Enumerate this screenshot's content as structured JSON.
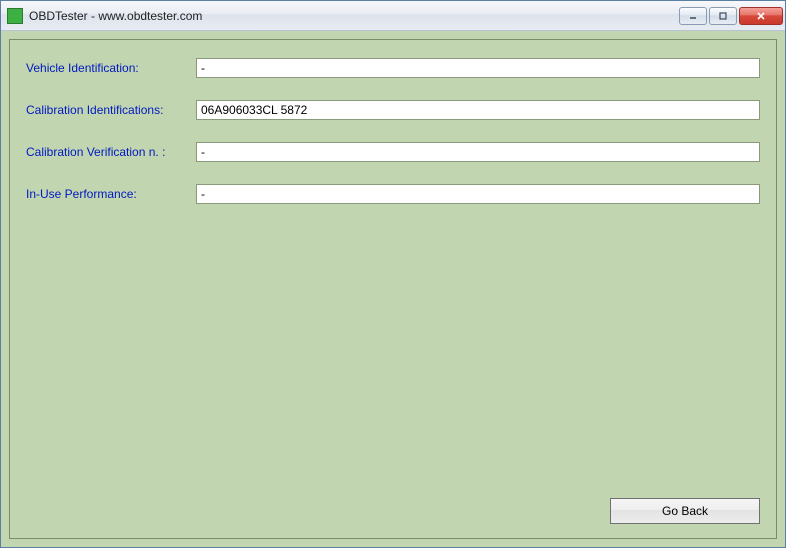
{
  "window": {
    "title": "OBDTester - www.obdtester.com"
  },
  "fields": {
    "vehicle_id": {
      "label": "Vehicle Identification:",
      "value": "-"
    },
    "calib_id": {
      "label": "Calibration Identifications:",
      "value": "06A906033CL 5872"
    },
    "calib_verif": {
      "label": "Calibration Verification n. :",
      "value": "-"
    },
    "inuse_perf": {
      "label": "In-Use Performance:",
      "value": "-"
    }
  },
  "buttons": {
    "go_back": "Go Back"
  }
}
